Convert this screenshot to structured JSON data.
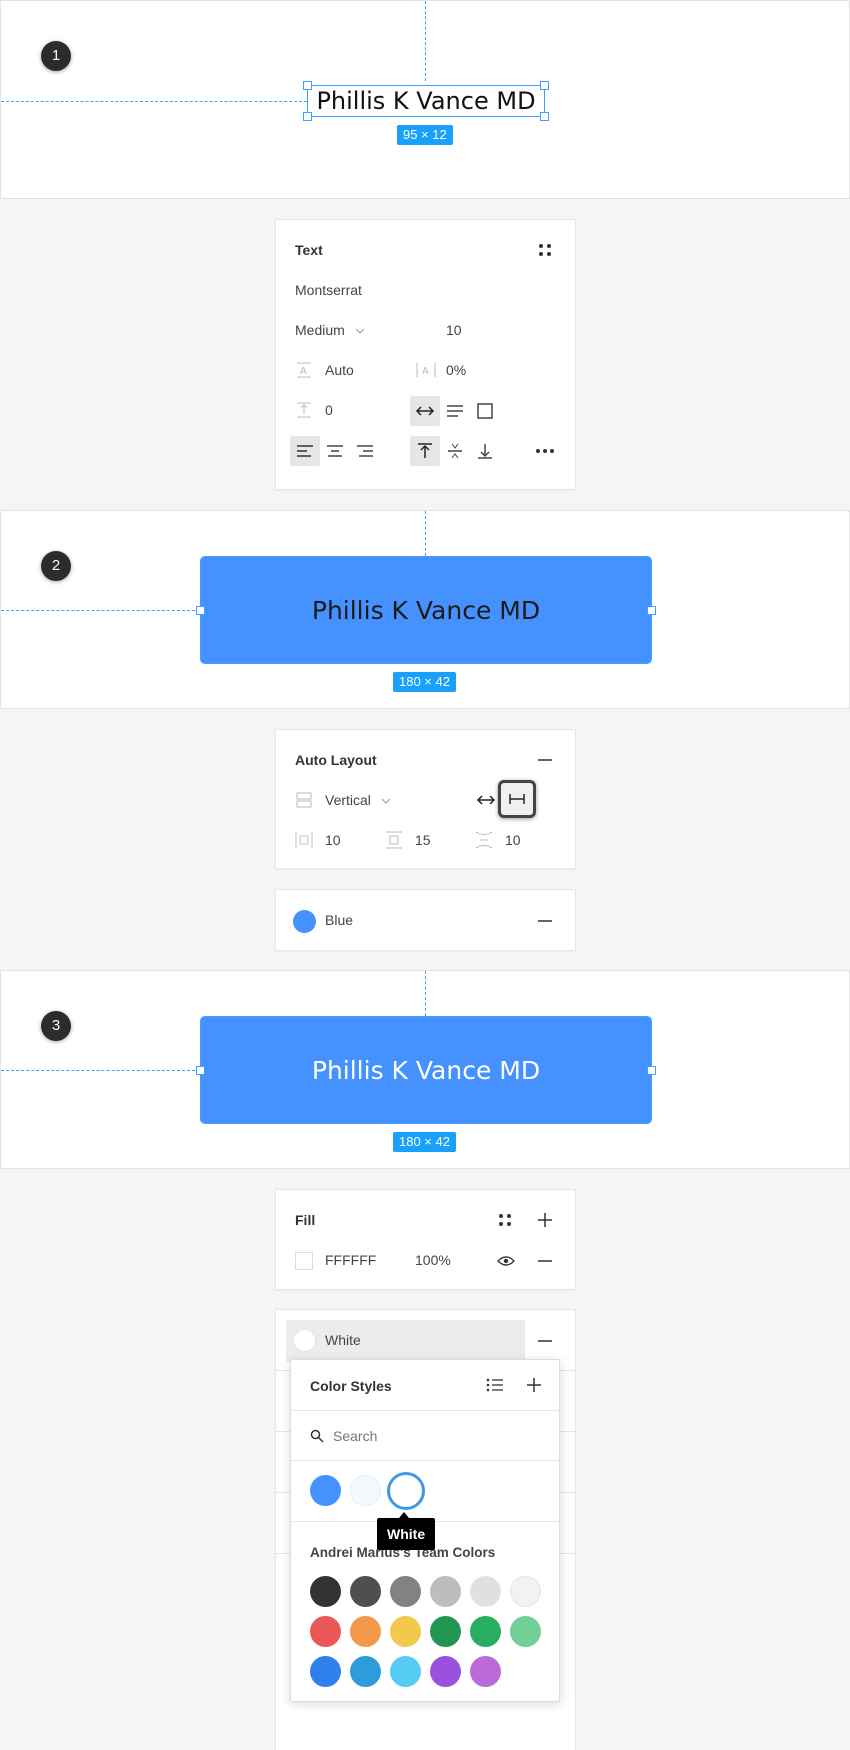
{
  "step1": {
    "number": "1",
    "label_text": "Phillis K Vance MD",
    "size_badge": "95 × 12"
  },
  "text_panel": {
    "title": "Text",
    "font_family": "Montserrat",
    "font_weight": "Medium",
    "font_size": "10",
    "line_height": "Auto",
    "letter_spacing": "0%",
    "paragraph_spacing": "0"
  },
  "step2": {
    "number": "2",
    "label_text": "Phillis K Vance MD",
    "size_badge": "180 × 42",
    "button_color": "#4592ff",
    "text_color": "#1a1a1a"
  },
  "auto_layout_panel": {
    "title": "Auto Layout",
    "direction": "Vertical",
    "horizontal_padding": "10",
    "vertical_padding": "15",
    "item_spacing": "10"
  },
  "color_style_row": {
    "name": "Blue",
    "color": "#4592ff"
  },
  "step3": {
    "number": "3",
    "label_text": "Phillis K Vance MD",
    "size_badge": "180 × 42",
    "text_color": "#ffffff"
  },
  "fill_panel": {
    "title": "Fill",
    "hex": "FFFFFF",
    "opacity": "100%"
  },
  "style_row": {
    "name": "White"
  },
  "color_styles_popup": {
    "title": "Color Styles",
    "search_placeholder": "Search",
    "local_swatches": [
      "#4592ff",
      "#f4f9ff",
      "#ffffff"
    ],
    "tooltip": "White",
    "team_title": "Andrei Marius's Team Colors",
    "team_swatches": [
      [
        "#333333",
        "#4f4f4f",
        "#828282",
        "#bdbdbd",
        "#e0e0e0",
        "#f2f2f2"
      ],
      [
        "#eb5757",
        "#f2994a",
        "#f2c94c",
        "#219653",
        "#27ae60",
        "#6fcf97"
      ],
      [
        "#2f80ed",
        "#2d9cdb",
        "#56ccf2",
        "#9b51e0",
        "#bb6bd9"
      ]
    ]
  }
}
